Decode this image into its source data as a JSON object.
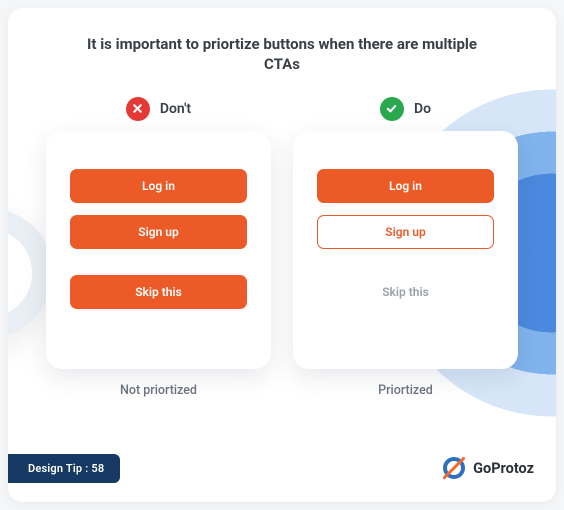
{
  "title": "It is important to priortize buttons when there are multiple CTAs",
  "dont": {
    "label": "Don't",
    "caption": "Not priortized",
    "buttons": {
      "login": "Log in",
      "signup": "Sign up",
      "skip": "Skip this"
    }
  },
  "do": {
    "label": "Do",
    "caption": "Priortized",
    "buttons": {
      "login": "Log in",
      "signup": "Sign up",
      "skip": "Skip this"
    }
  },
  "footer": {
    "tip": "Design Tip : 58",
    "brand": "GoProtoz"
  }
}
